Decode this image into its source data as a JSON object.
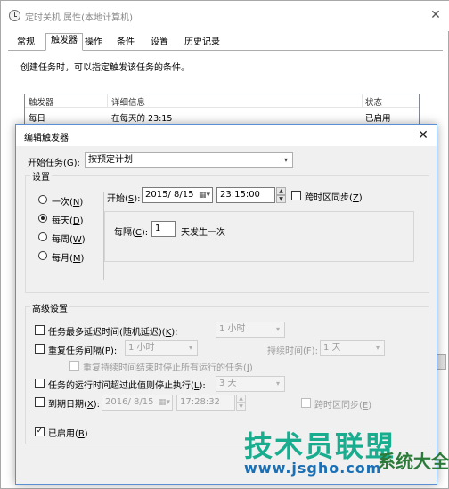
{
  "bg_window": {
    "title": "定时关机 属性(本地计算机)",
    "tabs": [
      "常规",
      "触发器",
      "操作",
      "条件",
      "设置",
      "历史记录"
    ],
    "active_tab": "触发器",
    "description": "创建任务时，可以指定触发该任务的条件。",
    "table": {
      "columns": [
        "触发器",
        "详细信息",
        "状态"
      ],
      "rows": [
        {
          "trigger": "每日",
          "details": "在每天的 23:15",
          "status": "已启用"
        }
      ]
    }
  },
  "dialog": {
    "title": "编辑触发器",
    "begin_task_label": "开始任务(",
    "begin_task_key": "G",
    "begin_task_suffix": "):",
    "begin_task_value": "按预定计划",
    "settings_group": "设置",
    "schedule_options": [
      {
        "label": "一次(",
        "key": "N",
        "suffix": ")",
        "selected": false
      },
      {
        "label": "每天(",
        "key": "D",
        "suffix": ")",
        "selected": true
      },
      {
        "label": "每周(",
        "key": "W",
        "suffix": ")",
        "selected": false
      },
      {
        "label": "每月(",
        "key": "M",
        "suffix": ")",
        "selected": false
      }
    ],
    "start_label": "开始(",
    "start_key": "S",
    "start_suffix": "):",
    "start_date": "2015/ 8/15",
    "start_time": "23:15:00",
    "sync_timezone_label": "跨时区同步(",
    "sync_timezone_key": "Z",
    "sync_timezone_suffix": ")",
    "sync_timezone_checked": false,
    "recur_label": "每隔(",
    "recur_key": "C",
    "recur_suffix": "):",
    "recur_value": "1",
    "recur_unit": "天发生一次",
    "advanced_group": "高级设置",
    "delay": {
      "label": "任务最多延迟时间(随机延迟)(",
      "key": "K",
      "suffix": "):",
      "value": "1 小时",
      "checked": false
    },
    "repeat": {
      "label": "重复任务间隔(",
      "key": "P",
      "suffix": "):",
      "value": "1 小时",
      "checked": false,
      "duration_label": "持续时间(",
      "duration_key": "F",
      "duration_suffix": "):",
      "duration_value": "1 天"
    },
    "stop_repeat": {
      "label": "重复持续时间结束时停止所有运行的任务(",
      "key": "I",
      "suffix": ")",
      "checked": false
    },
    "stop_long": {
      "label": "任务的运行时间超过此值则停止执行(",
      "key": "L",
      "suffix": "):",
      "value": "3 天",
      "checked": false
    },
    "expire": {
      "label": "到期日期(",
      "key": "X",
      "suffix": "):",
      "date": "2016/ 8/15",
      "time": "17:28:32",
      "checked": false,
      "sync_label": "跨时区同步(",
      "sync_key": "E",
      "sync_suffix": ")"
    },
    "enabled": {
      "label": "已启用(",
      "key": "B",
      "suffix": ")",
      "checked": true
    }
  },
  "watermark": {
    "main": "技术员联盟",
    "sub": "www.jsgho.com",
    "side": "系统大全"
  },
  "icons": {
    "close": "close-icon",
    "dropdown": "chevron-down-icon",
    "calendar": "calendar-icon",
    "check": "checkmark-icon"
  }
}
